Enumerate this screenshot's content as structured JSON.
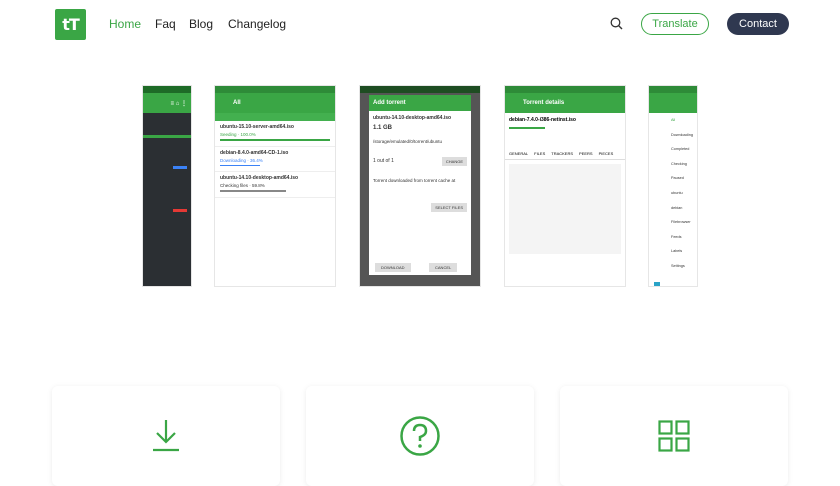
{
  "nav": {
    "logo_text": "tT",
    "links": [
      {
        "label": "Home",
        "active": true
      },
      {
        "label": "Faq",
        "active": false
      },
      {
        "label": "Blog",
        "active": false
      },
      {
        "label": "Changelog",
        "active": false
      }
    ],
    "translate_label": "Translate",
    "contact_label": "Contact"
  },
  "screenshots": {
    "shot2_title": "All",
    "shot2_items": [
      {
        "name": "ubuntu-15.10-server-amd64.iso",
        "status": "Seeding · 100.0%"
      },
      {
        "name": "debian-8.4.0-amd64-CD-1.iso",
        "status": "Downloading · 36.4%"
      },
      {
        "name": "ubuntu-14.10-desktop-amd64.iso",
        "status": "Checking files · 59.8%"
      }
    ],
    "shot3_dialog_title": "Add torrent",
    "shot3_name": "ubuntu-14.10-desktop-amd64.iso",
    "shot3_size": "1.1 GB",
    "shot3_path": "/storage/emulated/0/torrent/ubuntu",
    "shot3_change": "CHANGE",
    "shot3_files": "1 out of 1",
    "shot3_select_files": "SELECT FILES",
    "shot3_comment": "Torrent downloaded from torrent cache at",
    "shot3_download": "DOWNLOAD",
    "shot3_cancel": "CANCEL",
    "shot4_title": "Torrent details",
    "shot4_name": "debian-7.4.0-i386-netinst.iso",
    "shot4_tabs": [
      "GENERAL",
      "FILES",
      "TRACKERS",
      "PEERS",
      "PIECES"
    ],
    "shot5_menu": [
      "All",
      "Downloading",
      "Completed",
      "Checking",
      "Paused",
      "ubuntu",
      "debian",
      "Filebrowser",
      "Feeds",
      "Labels",
      "Settings"
    ]
  },
  "colors": {
    "brand": "#3aa645",
    "dark": "#2f3850"
  }
}
